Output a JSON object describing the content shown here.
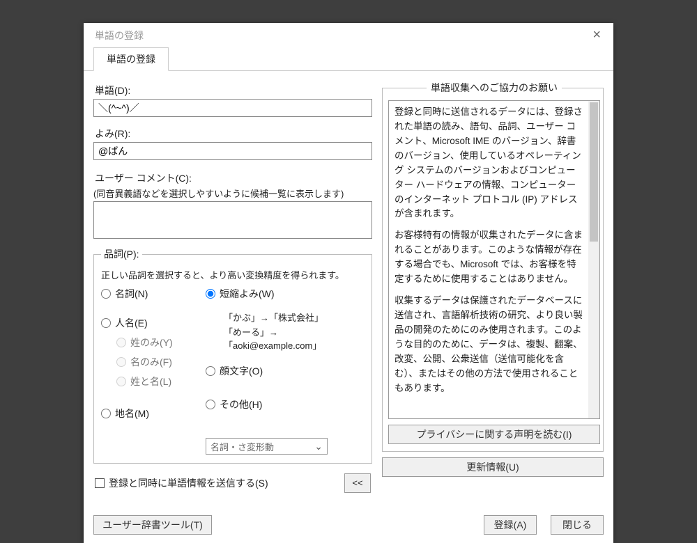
{
  "titlebar": {
    "title": "単語の登録"
  },
  "tab": {
    "label": "単語の登録"
  },
  "word": {
    "label": "単語(D):",
    "value": "＼(^~^)／"
  },
  "yomi": {
    "label": "よみ(R):",
    "value": "@ばん"
  },
  "comment": {
    "label": "ユーザー コメント(C):",
    "hint": "(同音異義語などを選択しやすいように候補一覧に表示します)",
    "value": ""
  },
  "pos": {
    "legend": "品詞(P):",
    "hint": "正しい品詞を選択すると、より高い変換精度を得られます。",
    "options": {
      "noun": "名詞(N)",
      "person": "人名(E)",
      "sei": "姓のみ(Y)",
      "mei": "名のみ(F)",
      "seimei": "姓と名(L)",
      "place": "地名(M)",
      "shortyomi": "短縮よみ(W)",
      "kaomoji": "顔文字(O)",
      "other": "その他(H)"
    },
    "selected": "shortyomi",
    "examples": {
      "ex1": "「かぶ」→「株式会社」",
      "ex2": "「めーる」→「aoki@example.com」"
    },
    "combo": {
      "value": "名詞・さ変形動"
    }
  },
  "sendCheckbox": {
    "label": "登録と同時に単語情報を送信する(S)"
  },
  "collapse": {
    "label": "<<"
  },
  "rightPane": {
    "legend": "単語収集へのご協力のお願い",
    "para1": "登録と同時に送信されるデータには、登録された単語の読み、語句、品詞、ユーザー コメント、Microsoft IME のバージョン、辞書のバージョン、使用しているオペレーティング システムのバージョンおよびコンピューター ハードウェアの情報、コンピューターのインターネット プロトコル (IP) アドレスが含まれます。",
    "para2": "お客様特有の情報が収集されたデータに含まれることがあります。このような情報が存在する場合でも、Microsoft では、お客様を特定するために使用することはありません。",
    "para3": "収集するデータは保護されたデータベースに送信され、言語解析技術の研究、より良い製品の開発のためにのみ使用されます。このような目的のために、データは、複製、翻案、改変、公開、公衆送信（送信可能化を含む）、またはその他の方法で使用されることもあります。",
    "privacyBtn": "プライバシーに関する声明を読む(I)",
    "updateBtn": "更新情報(U)"
  },
  "buttons": {
    "tool": "ユーザー辞書ツール(T)",
    "add": "登録(A)",
    "close": "閉じる"
  }
}
